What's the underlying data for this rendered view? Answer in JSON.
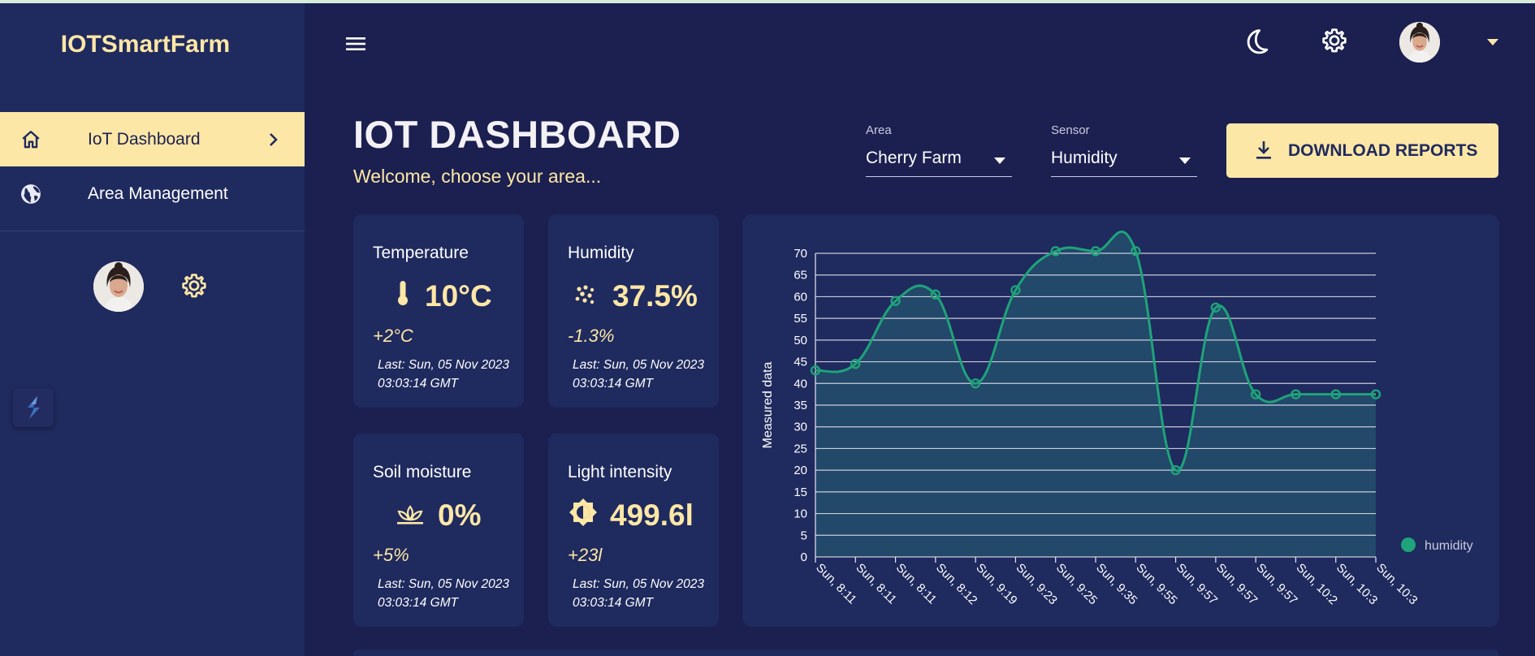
{
  "app": {
    "brand": "IOTSmartFarm"
  },
  "sidebar": {
    "items": [
      {
        "label": "IoT Dashboard",
        "icon": "home-icon",
        "active": true
      },
      {
        "label": "Area Management",
        "icon": "globe-icon",
        "active": false
      }
    ]
  },
  "header": {
    "title": "IOT DASHBOARD",
    "subtitle": "Welcome, choose your area...",
    "area_select": {
      "label": "Area",
      "value": "Cherry Farm"
    },
    "sensor_select": {
      "label": "Sensor",
      "value": "Humidity"
    },
    "download_label": "DOWNLOAD REPORTS"
  },
  "cards": [
    {
      "title": "Temperature",
      "icon": "thermometer-icon",
      "value": "10°C",
      "change": "+2°C",
      "last": "Last: Sun, 05 Nov 2023 03:03:14 GMT"
    },
    {
      "title": "Humidity",
      "icon": "humidity-dots-icon",
      "value": "37.5%",
      "change": "-1.3%",
      "last": "Last: Sun, 05 Nov 2023 03:03:14 GMT"
    },
    {
      "title": "Soil moisture",
      "icon": "sprout-icon",
      "value": "0%",
      "change": "+5%",
      "last": "Last: Sun, 05 Nov 2023 03:03:14 GMT"
    },
    {
      "title": "Light intensity",
      "icon": "brightness-icon",
      "value": "499.6l",
      "change": "+23l",
      "last": "Last: Sun, 05 Nov 2023 03:03:14 GMT"
    }
  ],
  "colors": {
    "background": "#1b2050",
    "panel": "#1f2a5e",
    "accent": "#fde7a6",
    "series": "#1fa37a"
  },
  "chart_data": {
    "type": "area",
    "ylabel": "Measured data",
    "xlabel": "",
    "ylim": [
      0,
      70
    ],
    "yticks": [
      0,
      5,
      10,
      15,
      20,
      25,
      30,
      35,
      40,
      45,
      50,
      55,
      60,
      65,
      70
    ],
    "grid": true,
    "legend": "bottom-right",
    "categories": [
      "Sun, 8:11",
      "Sun, 8:11",
      "Sun, 8:11",
      "Sun, 8:12",
      "Sun, 9:19",
      "Sun, 9:23",
      "Sun, 9:25",
      "Sun, 9:35",
      "Sun, 9:55",
      "Sun, 9:57",
      "Sun, 9:57",
      "Sun, 9:57",
      "Sun, 10:2",
      "Sun, 10:3",
      "Sun, 10:3"
    ],
    "series": [
      {
        "name": "humidity",
        "values": [
          43,
          44.5,
          59,
          60.5,
          40,
          61.5,
          70.5,
          70.5,
          70.5,
          20,
          57.5,
          37.5,
          37.5,
          37.5,
          37.5
        ]
      }
    ]
  }
}
